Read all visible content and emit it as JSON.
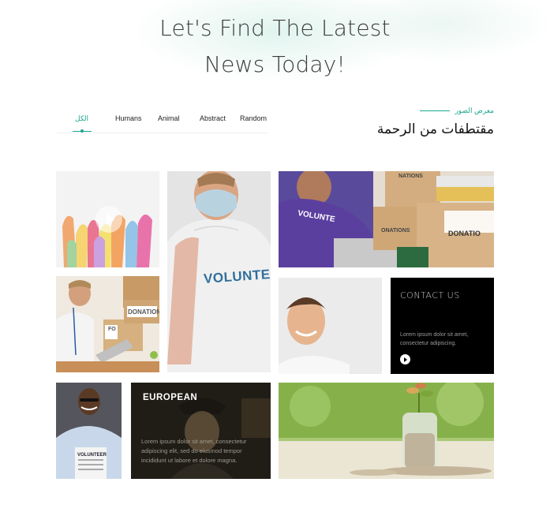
{
  "hero": {
    "line1": "Let's Find The Latest",
    "line2": "News Today!"
  },
  "filters": {
    "items": [
      "الكل",
      "Humans",
      "Animal",
      "Abstract",
      "Random"
    ],
    "active": "الكل",
    "accent": "#1aa68c"
  },
  "gallery": {
    "kicker": "معرض الصور",
    "title": "مقتطفات من الرحمة"
  },
  "tiles": {
    "hands": {
      "icon": "play-icon"
    },
    "volunteer_shirt": {
      "text": "VOLUNTE"
    },
    "volunteer_boxes": {
      "shirt_text": "VOLUNTE",
      "box1": "NATIONS",
      "box2": "ONATIONS",
      "box3": "DONATIO"
    },
    "donation_man": {
      "box_label": "DONATION",
      "box_small": "FO"
    },
    "smiling_man": {},
    "contact": {
      "title": "CONTACT US",
      "text": "Lorem ipsum dolor sit amet, consectetur adipiscing.",
      "icon": "play-icon"
    },
    "volunteer_clipboard": {
      "label": "VOLUNTEER"
    },
    "european": {
      "title": "EUROPEAN",
      "text": "Lorem ipsum dolor sit amet, consectetur adipiscing elit, sed do eiusmod tempor incididunt ut labore et dolore magna."
    },
    "coins_jar": {}
  }
}
